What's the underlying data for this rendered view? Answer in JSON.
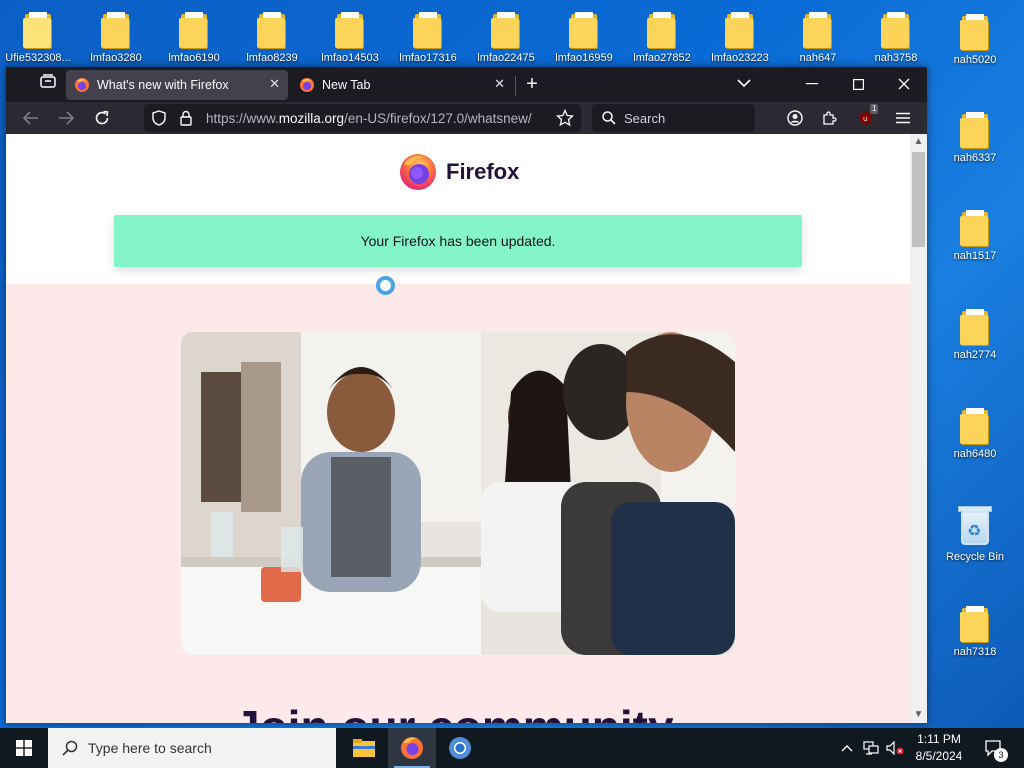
{
  "desktop": {
    "top_row_icons": [
      "Ufie532308...",
      "lmfao3280",
      "lmfao6190",
      "lmfao8239",
      "lmfao14503",
      "lmfao17316",
      "lmfao22475",
      "lmfao16959",
      "lmfao27852",
      "lmfao23223",
      "nah647",
      "nah3758"
    ],
    "right_column_icons": [
      "nah5020",
      "nah6337",
      "nah1517",
      "nah2774",
      "nah6480",
      "Recycle Bin",
      "nah7318"
    ]
  },
  "browser": {
    "tabs": [
      {
        "title": "What's new with Firefox",
        "active": true
      },
      {
        "title": "New Tab",
        "active": false
      }
    ],
    "new_tab_symbol": "+",
    "url_prefix": "https://www.",
    "url_domain": "mozilla.org",
    "url_path": "/en-US/firefox/127.0/whatsnew/",
    "search_placeholder": "Search",
    "extension_badge": "1",
    "page": {
      "brand_name": "Firefox",
      "update_notice": "Your Firefox has been updated.",
      "headline": "Join our community"
    }
  },
  "taskbar": {
    "search_placeholder": "Type here to search",
    "time": "1:11 PM",
    "date": "8/5/2024",
    "notification_count": "3"
  },
  "colors": {
    "notice_bg": "#83f5c9",
    "page_bg": "#fde9ea",
    "browser_chrome": "#1c1b22",
    "desktop_bg": "#0a63c9"
  }
}
